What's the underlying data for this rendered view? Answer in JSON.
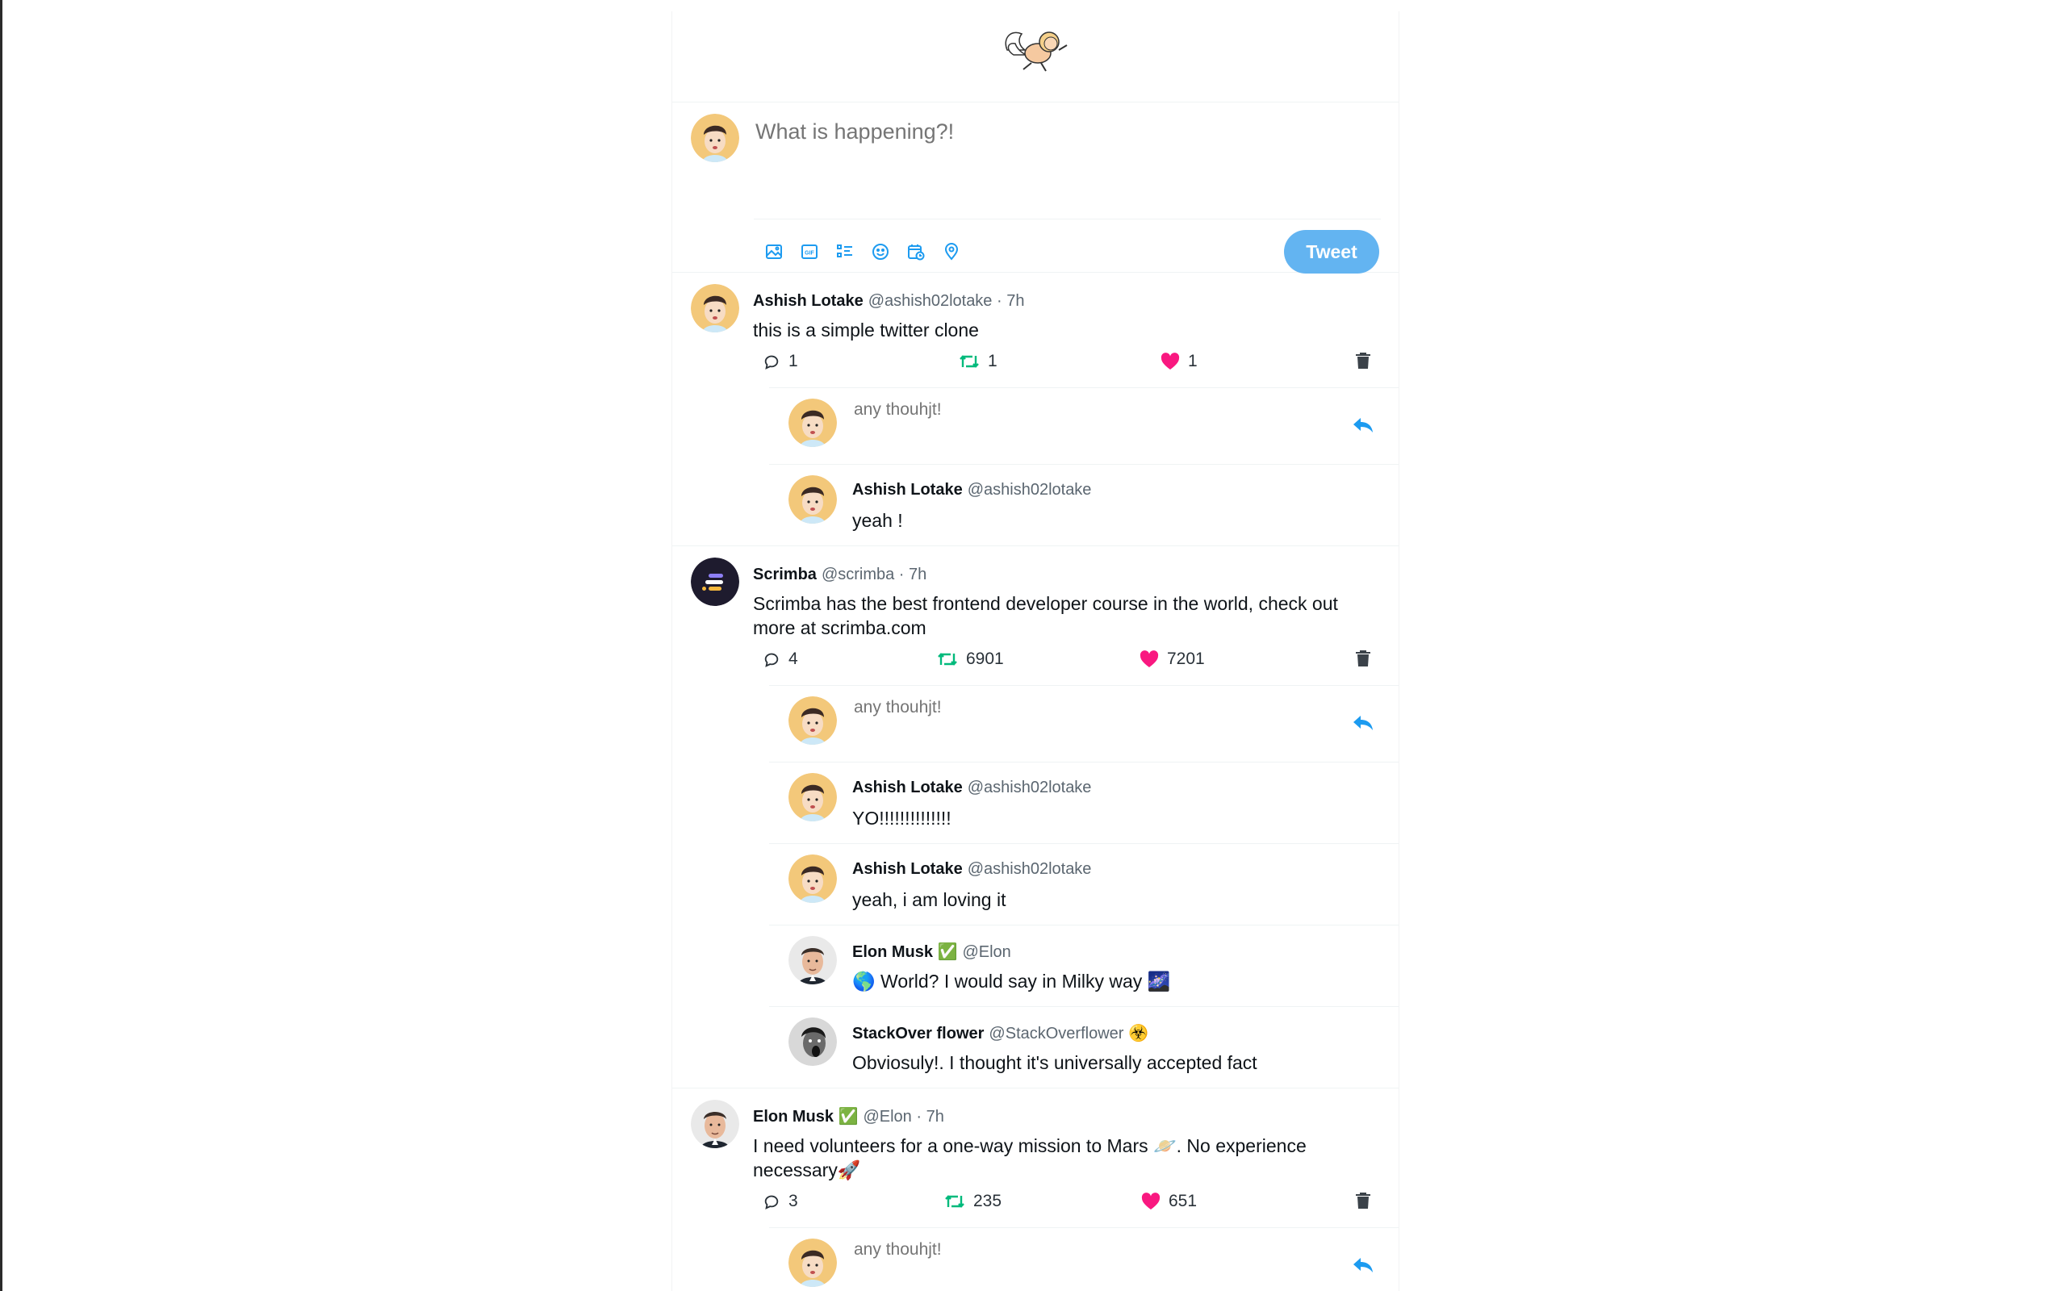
{
  "compose": {
    "placeholder": "What is happening?!",
    "tweet_label": "Tweet",
    "tools": [
      "image-icon",
      "gif-icon",
      "poll-icon",
      "emoji-icon",
      "schedule-icon",
      "location-icon"
    ]
  },
  "reply_placeholder": "any thouhjt!",
  "tweets": [
    {
      "name": "Ashish Lotake",
      "handle": "@ashish02lotake · 7h",
      "text": "this is a simple twitter clone",
      "replies_count": "1",
      "retweets": "1",
      "likes": "1",
      "replies": [
        {
          "name": "Ashish Lotake",
          "handle": "@ashish02lotake",
          "text": "yeah !"
        }
      ]
    },
    {
      "name": "Scrimba",
      "handle": "@scrimba · 7h",
      "text": "Scrimba has the best frontend developer course in the world, check out more at scrimba.com",
      "replies_count": "4",
      "retweets": "6901",
      "likes": "7201",
      "replies": [
        {
          "name": "Ashish Lotake",
          "handle": "@ashish02lotake",
          "text": "YO!!!!!!!!!!!!!!"
        },
        {
          "name": "Ashish Lotake",
          "handle": "@ashish02lotake",
          "text": "yeah, i am loving it"
        },
        {
          "name": "Elon Musk ✅",
          "handle": "@Elon",
          "text": "🌎 World? I would say in Milky way 🌌"
        },
        {
          "name": "StackOver flower",
          "handle": "@StackOverflower ☣️",
          "text": "Obviosuly!. I thought it's universally accepted fact"
        }
      ]
    },
    {
      "name": "Elon Musk ✅",
      "handle": "@Elon · 7h",
      "text": "I need volunteers for a one-way mission to Mars 🪐. No experience necessary🚀",
      "replies_count": "3",
      "retweets": "235",
      "likes": "651",
      "replies": []
    }
  ],
  "colors": {
    "accent": "#1d9bf0",
    "tweet_button": "#63b4f1",
    "retweet": "#00ba7c",
    "like": "#f91880"
  }
}
